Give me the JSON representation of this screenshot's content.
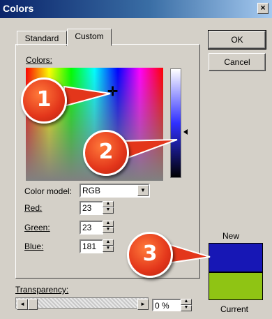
{
  "window": {
    "title": "Colors",
    "close_glyph": "×"
  },
  "tabs": [
    {
      "label": "Standard"
    },
    {
      "label": "Custom"
    }
  ],
  "buttons": {
    "ok": "OK",
    "cancel": "Cancel"
  },
  "labels": {
    "colors": "Colors:",
    "color_model": "Color model:",
    "red": "Red:",
    "green": "Green:",
    "blue": "Blue:",
    "transparency": "Transparency:",
    "new": "New",
    "current": "Current"
  },
  "fields": {
    "color_model": "RGB",
    "red": "23",
    "green": "23",
    "blue": "181",
    "transparency": "0 %"
  },
  "colors": {
    "new_swatch": "#1717b5",
    "current_swatch": "#8fc414",
    "callout": "#e3361b"
  },
  "callouts": [
    {
      "number": "1"
    },
    {
      "number": "2"
    },
    {
      "number": "3"
    }
  ],
  "transparency_level_percent": 0
}
